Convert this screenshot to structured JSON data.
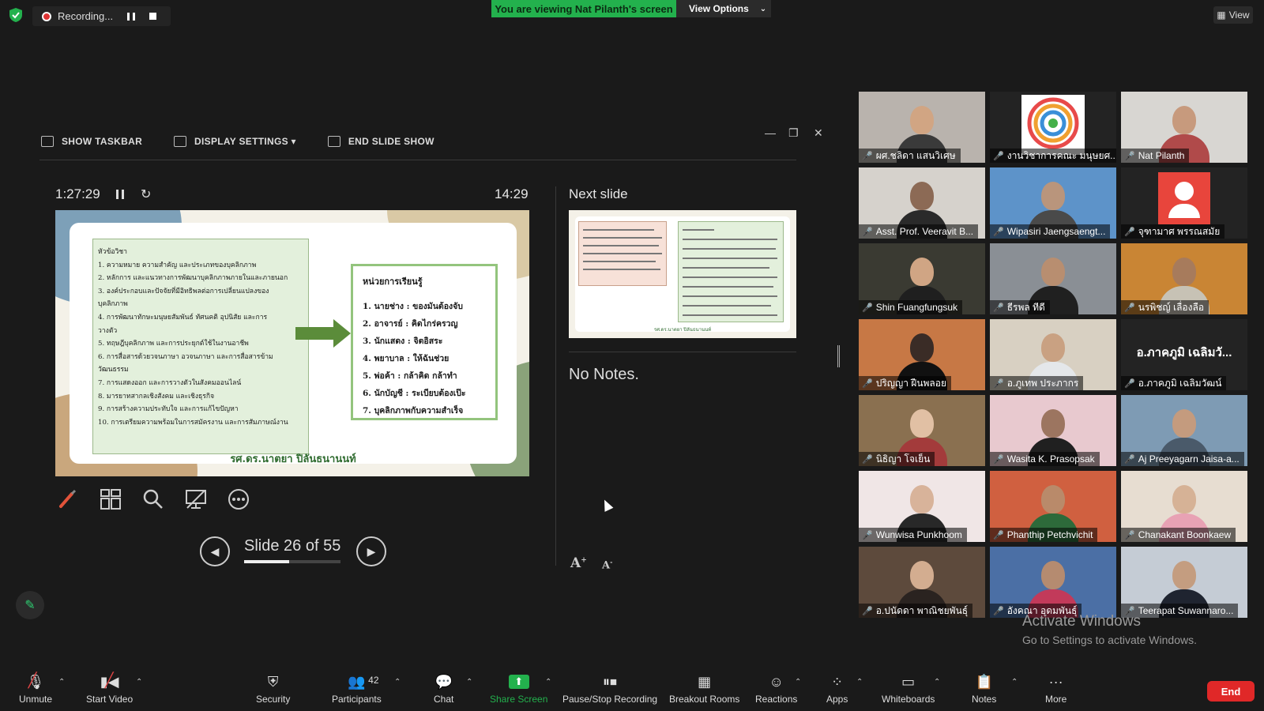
{
  "top": {
    "recording_label": "Recording...",
    "viewing_banner": "You are viewing Nat Pilanth's screen",
    "view_options": "View Options",
    "view_button": "View"
  },
  "presenter": {
    "toolbar": {
      "show_taskbar": "SHOW TASKBAR",
      "display_settings": "DISPLAY SETTINGS ▾",
      "end_slide_show": "END SLIDE SHOW"
    },
    "elapsed": "1:27:29",
    "clock": "14:29",
    "slide_number": "Slide 26 of 55",
    "progress_fraction": 0.47,
    "next_slide_title": "Next slide",
    "notes": "No Notes."
  },
  "slide": {
    "left_items": [
      "หัวข้อวิชา",
      "1. ความหมาย ความสำคัญ และประเภทของบุคลิกภาพ",
      "2. หลักการ และแนวทางการพัฒนาบุคลิกภาพภายในและภายนอก",
      "3. องค์ประกอบและปัจจัยที่มีอิทธิพลต่อการเปลี่ยนแปลงของ",
      "บุคลิกภาพ",
      "4. การพัฒนาทักษะมนุษยสัมพันธ์ ทัศนคติ อุปนิสัย และการ",
      "วางตัว",
      "5. ทฤษฎีบุคลิกภาพ และการประยุกต์ใช้ในงานอาชีพ",
      "6. การสื่อสารด้วยวจนภาษา อวจนภาษา และการสื่อสารข้าม",
      "วัฒนธรรม",
      "7. การแสดงออก และการวางตัวในสังคมออนไลน์",
      "8. มารยาทสากลเชิงสังคม และเชิงธุรกิจ",
      "9. การสร้างความประทับใจ และการแก้ไขปัญหา",
      "10. การเตรียมความพร้อมในการสมัครงาน และการสัมภาษณ์งาน"
    ],
    "right_heading": "หน่วยการเรียนรู้",
    "right_items": [
      "1. นายช่าง : ของมันต้องจับ",
      "2. อาจารย์ : คิดไกร่ครวญ",
      "3. นักแสดง : จิตอิสระ",
      "4. พยาบาล : ให้ฉันช่วย",
      "5. พ่อค้า : กล้าคิด กล้าทำ",
      "6. นักบัญชี : ระเบียบต้องเป๊ะ",
      "7. บุคลิกภาพกับความสำเร็จ"
    ],
    "author": "รศ.ดร.นาตยา ปิลันธนานนท์"
  },
  "next_slide": {
    "caption": "รศ.ดร.นาตยา ปิลันธนานนท์"
  },
  "participants": [
    {
      "name": "ผศ.ชลิดา แสนวิเศษ",
      "type": "video",
      "bg": "#b9b3ad",
      "skin": "#d1a583",
      "shirt": "#3a3a3a"
    },
    {
      "name": "งานวิชาการคณะ มนุษยศ...",
      "type": "logo",
      "bg": "#ffffff"
    },
    {
      "name": "Nat Pilanth",
      "type": "video",
      "bg": "#d8d6d2",
      "skin": "#c79a7d",
      "shirt": "#b04a4a",
      "active": true
    },
    {
      "name": "Asst. Prof. Veeravit B...",
      "type": "video",
      "bg": "#d6d2cc",
      "skin": "#8c6a55",
      "shirt": "#2a2a2a"
    },
    {
      "name": "Wipasiri Jaengsaengt...",
      "type": "video",
      "bg": "#5d93c9",
      "skin": "#b9957c",
      "shirt": "#4a4a4a"
    },
    {
      "name": "จุฑามาศ พรรณสมัย",
      "type": "avatar"
    },
    {
      "name": "Shin Fuangfungsuk",
      "type": "video",
      "bg": "#3a3a32",
      "skin": "#d0a584",
      "shirt": "#1f1f1f"
    },
    {
      "name": "ธีรพล ทีดี",
      "type": "video",
      "bg": "#8a8f95",
      "skin": "#b88e70",
      "shirt": "#202020"
    },
    {
      "name": "นรพิชญ์ เลื่องลือ",
      "type": "video",
      "bg": "#c98534",
      "skin": "#a77b5c",
      "shirt": "#c7c2b5"
    },
    {
      "name": "ปริญญา ฝืนพลอย",
      "type": "video",
      "bg": "#c77845",
      "skin": "#3a2c26",
      "shirt": "#111111"
    },
    {
      "name": "อ.ภูเทพ ประภากร",
      "type": "video",
      "bg": "#d8d0c2",
      "skin": "#c9a182",
      "shirt": "#e4e7ea"
    },
    {
      "name": "อ.ภาคภูมิ เฉลิมวัฒน์",
      "type": "name",
      "display": "อ.ภาคภูมิ เฉลิมวั..."
    },
    {
      "name": "นิธิญา โจเย็น",
      "type": "video",
      "bg": "#8a7050",
      "skin": "#e1c0a4",
      "shirt": "#a33b3b"
    },
    {
      "name": "Wasita K. Prasopsak",
      "type": "video",
      "bg": "#e8c9cf",
      "skin": "#9c7560",
      "shirt": "#202020"
    },
    {
      "name": "Aj Preeyagarn Jaisa-a...",
      "type": "video",
      "bg": "#7e9bb4",
      "skin": "#c49b7e",
      "shirt": "#4a5a6a"
    },
    {
      "name": "Wunwisa Punkhoom",
      "type": "video",
      "bg": "#f0e6e6",
      "skin": "#d8b39a",
      "shirt": "#282828"
    },
    {
      "name": "Phanthip Petchvichit",
      "type": "video",
      "bg": "#d06040",
      "skin": "#b98a6a",
      "shirt": "#2d6a3a"
    },
    {
      "name": "Chanakant Boonkaew",
      "type": "video",
      "bg": "#e7ddd1",
      "skin": "#d6b296",
      "shirt": "#e8a2b4"
    },
    {
      "name": "อ.ปนัดดา พาณิชยพันธุ์",
      "type": "video",
      "bg": "#5d4a3c",
      "skin": "#d3ad90",
      "shirt": "#2a2320"
    },
    {
      "name": "อังคณา อุดมพันธุ์",
      "type": "video",
      "bg": "#4b6fa5",
      "skin": "#b58b70",
      "shirt": "#c23a5a"
    },
    {
      "name": "Teerapat Suwannaro...",
      "type": "video",
      "bg": "#c5ccd5",
      "skin": "#c49d80",
      "shirt": "#1f2430"
    }
  ],
  "activate_windows": {
    "title": "Activate Windows",
    "subtitle": "Go to Settings to activate Windows."
  },
  "toolbar": {
    "unmute": "Unmute",
    "start_video": "Start Video",
    "security": "Security",
    "participants": "Participants",
    "participant_count": "42",
    "chat": "Chat",
    "share_screen": "Share Screen",
    "pause_stop_recording": "Pause/Stop Recording",
    "breakout_rooms": "Breakout Rooms",
    "reactions": "Reactions",
    "apps": "Apps",
    "whiteboards": "Whiteboards",
    "notes": "Notes",
    "more": "More",
    "end": "End"
  },
  "colors": {
    "accent_green": "#23b14d",
    "end_red": "#e02828",
    "active_speaker": "#e8e463"
  }
}
